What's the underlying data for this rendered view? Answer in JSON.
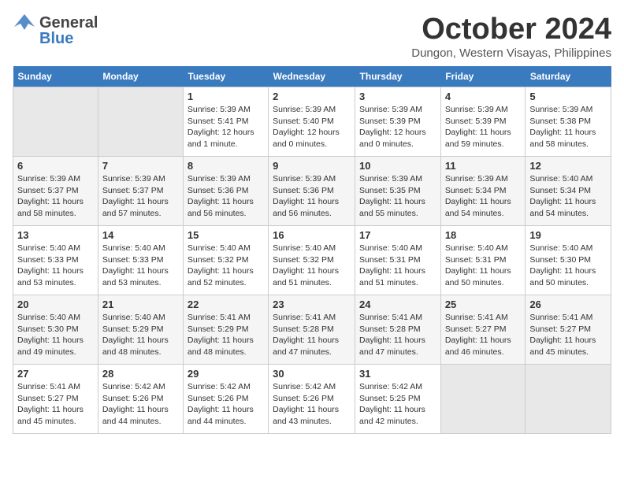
{
  "header": {
    "logo_general": "General",
    "logo_blue": "Blue",
    "month": "October 2024",
    "location": "Dungon, Western Visayas, Philippines"
  },
  "days_of_week": [
    "Sunday",
    "Monday",
    "Tuesday",
    "Wednesday",
    "Thursday",
    "Friday",
    "Saturday"
  ],
  "weeks": [
    [
      {
        "day": "",
        "content": ""
      },
      {
        "day": "",
        "content": ""
      },
      {
        "day": "1",
        "content": "Sunrise: 5:39 AM\nSunset: 5:41 PM\nDaylight: 12 hours\nand 1 minute."
      },
      {
        "day": "2",
        "content": "Sunrise: 5:39 AM\nSunset: 5:40 PM\nDaylight: 12 hours\nand 0 minutes."
      },
      {
        "day": "3",
        "content": "Sunrise: 5:39 AM\nSunset: 5:39 PM\nDaylight: 12 hours\nand 0 minutes."
      },
      {
        "day": "4",
        "content": "Sunrise: 5:39 AM\nSunset: 5:39 PM\nDaylight: 11 hours\nand 59 minutes."
      },
      {
        "day": "5",
        "content": "Sunrise: 5:39 AM\nSunset: 5:38 PM\nDaylight: 11 hours\nand 58 minutes."
      }
    ],
    [
      {
        "day": "6",
        "content": "Sunrise: 5:39 AM\nSunset: 5:37 PM\nDaylight: 11 hours\nand 58 minutes."
      },
      {
        "day": "7",
        "content": "Sunrise: 5:39 AM\nSunset: 5:37 PM\nDaylight: 11 hours\nand 57 minutes."
      },
      {
        "day": "8",
        "content": "Sunrise: 5:39 AM\nSunset: 5:36 PM\nDaylight: 11 hours\nand 56 minutes."
      },
      {
        "day": "9",
        "content": "Sunrise: 5:39 AM\nSunset: 5:36 PM\nDaylight: 11 hours\nand 56 minutes."
      },
      {
        "day": "10",
        "content": "Sunrise: 5:39 AM\nSunset: 5:35 PM\nDaylight: 11 hours\nand 55 minutes."
      },
      {
        "day": "11",
        "content": "Sunrise: 5:39 AM\nSunset: 5:34 PM\nDaylight: 11 hours\nand 54 minutes."
      },
      {
        "day": "12",
        "content": "Sunrise: 5:40 AM\nSunset: 5:34 PM\nDaylight: 11 hours\nand 54 minutes."
      }
    ],
    [
      {
        "day": "13",
        "content": "Sunrise: 5:40 AM\nSunset: 5:33 PM\nDaylight: 11 hours\nand 53 minutes."
      },
      {
        "day": "14",
        "content": "Sunrise: 5:40 AM\nSunset: 5:33 PM\nDaylight: 11 hours\nand 53 minutes."
      },
      {
        "day": "15",
        "content": "Sunrise: 5:40 AM\nSunset: 5:32 PM\nDaylight: 11 hours\nand 52 minutes."
      },
      {
        "day": "16",
        "content": "Sunrise: 5:40 AM\nSunset: 5:32 PM\nDaylight: 11 hours\nand 51 minutes."
      },
      {
        "day": "17",
        "content": "Sunrise: 5:40 AM\nSunset: 5:31 PM\nDaylight: 11 hours\nand 51 minutes."
      },
      {
        "day": "18",
        "content": "Sunrise: 5:40 AM\nSunset: 5:31 PM\nDaylight: 11 hours\nand 50 minutes."
      },
      {
        "day": "19",
        "content": "Sunrise: 5:40 AM\nSunset: 5:30 PM\nDaylight: 11 hours\nand 50 minutes."
      }
    ],
    [
      {
        "day": "20",
        "content": "Sunrise: 5:40 AM\nSunset: 5:30 PM\nDaylight: 11 hours\nand 49 minutes."
      },
      {
        "day": "21",
        "content": "Sunrise: 5:40 AM\nSunset: 5:29 PM\nDaylight: 11 hours\nand 48 minutes."
      },
      {
        "day": "22",
        "content": "Sunrise: 5:41 AM\nSunset: 5:29 PM\nDaylight: 11 hours\nand 48 minutes."
      },
      {
        "day": "23",
        "content": "Sunrise: 5:41 AM\nSunset: 5:28 PM\nDaylight: 11 hours\nand 47 minutes."
      },
      {
        "day": "24",
        "content": "Sunrise: 5:41 AM\nSunset: 5:28 PM\nDaylight: 11 hours\nand 47 minutes."
      },
      {
        "day": "25",
        "content": "Sunrise: 5:41 AM\nSunset: 5:27 PM\nDaylight: 11 hours\nand 46 minutes."
      },
      {
        "day": "26",
        "content": "Sunrise: 5:41 AM\nSunset: 5:27 PM\nDaylight: 11 hours\nand 45 minutes."
      }
    ],
    [
      {
        "day": "27",
        "content": "Sunrise: 5:41 AM\nSunset: 5:27 PM\nDaylight: 11 hours\nand 45 minutes."
      },
      {
        "day": "28",
        "content": "Sunrise: 5:42 AM\nSunset: 5:26 PM\nDaylight: 11 hours\nand 44 minutes."
      },
      {
        "day": "29",
        "content": "Sunrise: 5:42 AM\nSunset: 5:26 PM\nDaylight: 11 hours\nand 44 minutes."
      },
      {
        "day": "30",
        "content": "Sunrise: 5:42 AM\nSunset: 5:26 PM\nDaylight: 11 hours\nand 43 minutes."
      },
      {
        "day": "31",
        "content": "Sunrise: 5:42 AM\nSunset: 5:25 PM\nDaylight: 11 hours\nand 42 minutes."
      },
      {
        "day": "",
        "content": ""
      },
      {
        "day": "",
        "content": ""
      }
    ]
  ]
}
